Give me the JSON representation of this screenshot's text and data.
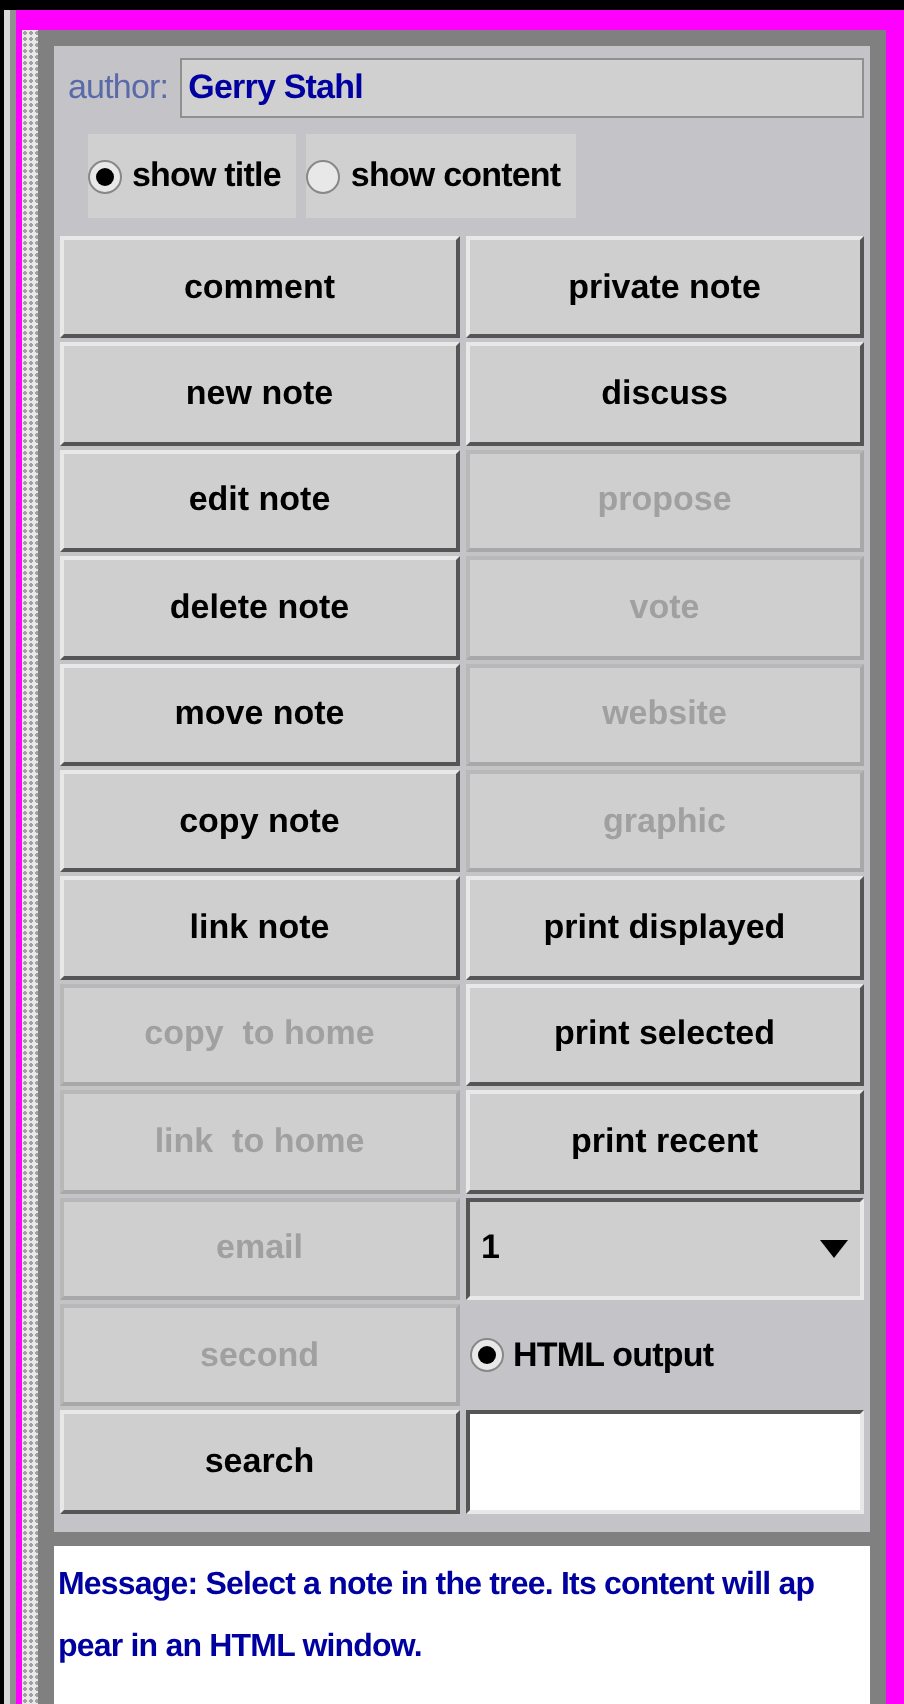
{
  "author": {
    "label": "author:",
    "value": "Gerry Stahl"
  },
  "view_options": [
    {
      "label": "show title",
      "selected": true
    },
    {
      "label": "show content",
      "selected": false
    }
  ],
  "controls": [
    {
      "kind": "button",
      "label": "comment",
      "disabled": false
    },
    {
      "kind": "button",
      "label": "private note",
      "disabled": false
    },
    {
      "kind": "button",
      "label": "new note",
      "disabled": false
    },
    {
      "kind": "button",
      "label": "discuss",
      "disabled": false
    },
    {
      "kind": "button",
      "label": "edit note",
      "disabled": false
    },
    {
      "kind": "button",
      "label": "propose",
      "disabled": true
    },
    {
      "kind": "button",
      "label": "delete note",
      "disabled": false
    },
    {
      "kind": "button",
      "label": "vote",
      "disabled": true
    },
    {
      "kind": "button",
      "label": "move note",
      "disabled": false
    },
    {
      "kind": "button",
      "label": "website",
      "disabled": true
    },
    {
      "kind": "button",
      "label": "copy note",
      "disabled": false
    },
    {
      "kind": "button",
      "label": "graphic",
      "disabled": true
    },
    {
      "kind": "button",
      "label": "link note",
      "disabled": false
    },
    {
      "kind": "button",
      "label": "print displayed",
      "disabled": false
    },
    {
      "kind": "button",
      "label": "copy  to home",
      "disabled": true
    },
    {
      "kind": "button",
      "label": "print selected",
      "disabled": false
    },
    {
      "kind": "button",
      "label": "link  to home",
      "disabled": true
    },
    {
      "kind": "button",
      "label": "print recent",
      "disabled": false
    },
    {
      "kind": "button",
      "label": "email",
      "disabled": true
    },
    {
      "kind": "combo",
      "value": "1"
    },
    {
      "kind": "button",
      "label": "second",
      "disabled": true
    },
    {
      "kind": "radio",
      "label": "HTML output",
      "selected": true
    },
    {
      "kind": "button",
      "label": "search",
      "disabled": false
    },
    {
      "kind": "field"
    }
  ],
  "message": [
    "Message: Select a note in the tree. Its content will ap",
    "pear in an HTML window."
  ]
}
